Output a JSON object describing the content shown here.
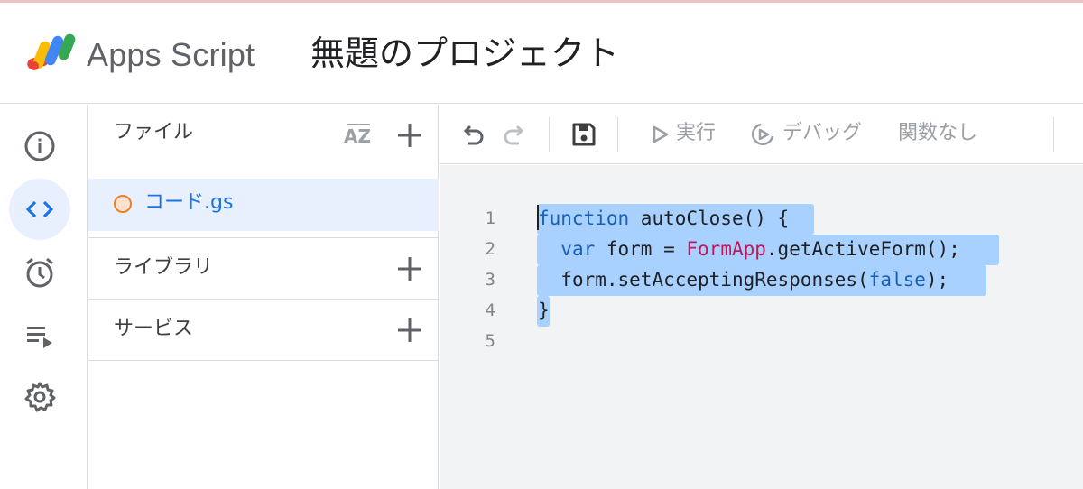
{
  "header": {
    "app_name": "Apps Script",
    "project_title": "無題のプロジェクト"
  },
  "rail": {
    "items": [
      {
        "icon": "info-icon",
        "active": false
      },
      {
        "icon": "code-icon",
        "active": true
      },
      {
        "icon": "alarm-clock-icon",
        "active": false
      },
      {
        "icon": "executions-icon",
        "active": false
      },
      {
        "icon": "gear-icon",
        "active": false
      }
    ]
  },
  "files_panel": {
    "files_label": "ファイル",
    "sort_icon_text": "AZ",
    "files": [
      {
        "name": "コード.gs",
        "selected": true
      }
    ],
    "libraries_label": "ライブラリ",
    "services_label": "サービス"
  },
  "toolbar": {
    "run_label": "実行",
    "debug_label": "デバッグ",
    "function_select": "関数なし"
  },
  "editor": {
    "line_numbers": [
      "1",
      "2",
      "3",
      "4",
      "5"
    ],
    "lines": [
      {
        "kw1": "function",
        "rest": " autoClose() {"
      },
      {
        "indent": "  ",
        "kw1": "var",
        "mid": " form = ",
        "cls": "FormApp",
        "rest": ".getActiveForm();"
      },
      {
        "indent": "  ",
        "pre": "form.setAcceptingResponses(",
        "kw1": "false",
        "rest": ");"
      },
      {
        "rest": "}"
      },
      {
        "rest": ""
      }
    ]
  },
  "colors": {
    "accent": "#1a73e8",
    "selection": "#a8d1ff",
    "active_bg": "#e8f0fe",
    "file_dot": "#e8812f"
  }
}
